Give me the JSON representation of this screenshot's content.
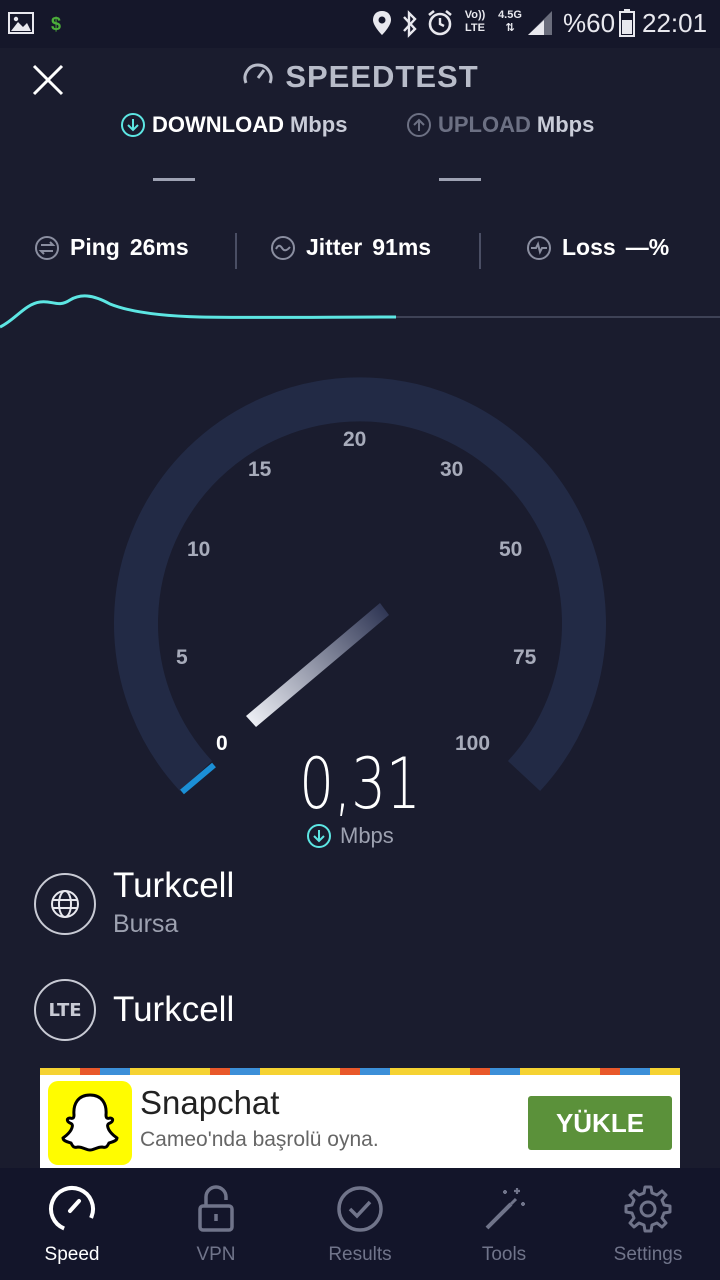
{
  "status_bar": {
    "battery_text": "%60",
    "time": "22:01",
    "network_type": "4.5G",
    "volte_top": "Vo))",
    "volte_bottom": "LTE"
  },
  "header": {
    "title": "SPEEDTEST",
    "download_label": "DOWNLOAD",
    "download_unit": "Mbps",
    "upload_label": "UPLOAD",
    "upload_unit": "Mbps"
  },
  "stats": {
    "ping_label": "Ping",
    "ping_value": "26ms",
    "jitter_label": "Jitter",
    "jitter_value": "91ms",
    "loss_label": "Loss",
    "loss_value": "—%"
  },
  "gauge": {
    "ticks": [
      "0",
      "5",
      "10",
      "15",
      "20",
      "30",
      "50",
      "75",
      "100"
    ],
    "speed_value": "0,31",
    "speed_unit": "Mbps"
  },
  "server": {
    "provider": "Turkcell",
    "city": "Bursa"
  },
  "connection": {
    "badge": "LTE",
    "provider": "Turkcell"
  },
  "ad": {
    "title": "Snapchat",
    "subtitle": "Cameo'nda başrolü oyna.",
    "button": "YÜKLE"
  },
  "nav": [
    {
      "label": "Speed"
    },
    {
      "label": "VPN"
    },
    {
      "label": "Results"
    },
    {
      "label": "Tools"
    },
    {
      "label": "Settings"
    }
  ],
  "colors": {
    "background": "#1a1c2e",
    "accent_cyan": "#5de6e3",
    "gauge_track": "#222a45",
    "gauge_progress": "#1b8fd6",
    "ad_button": "#5b913a"
  }
}
